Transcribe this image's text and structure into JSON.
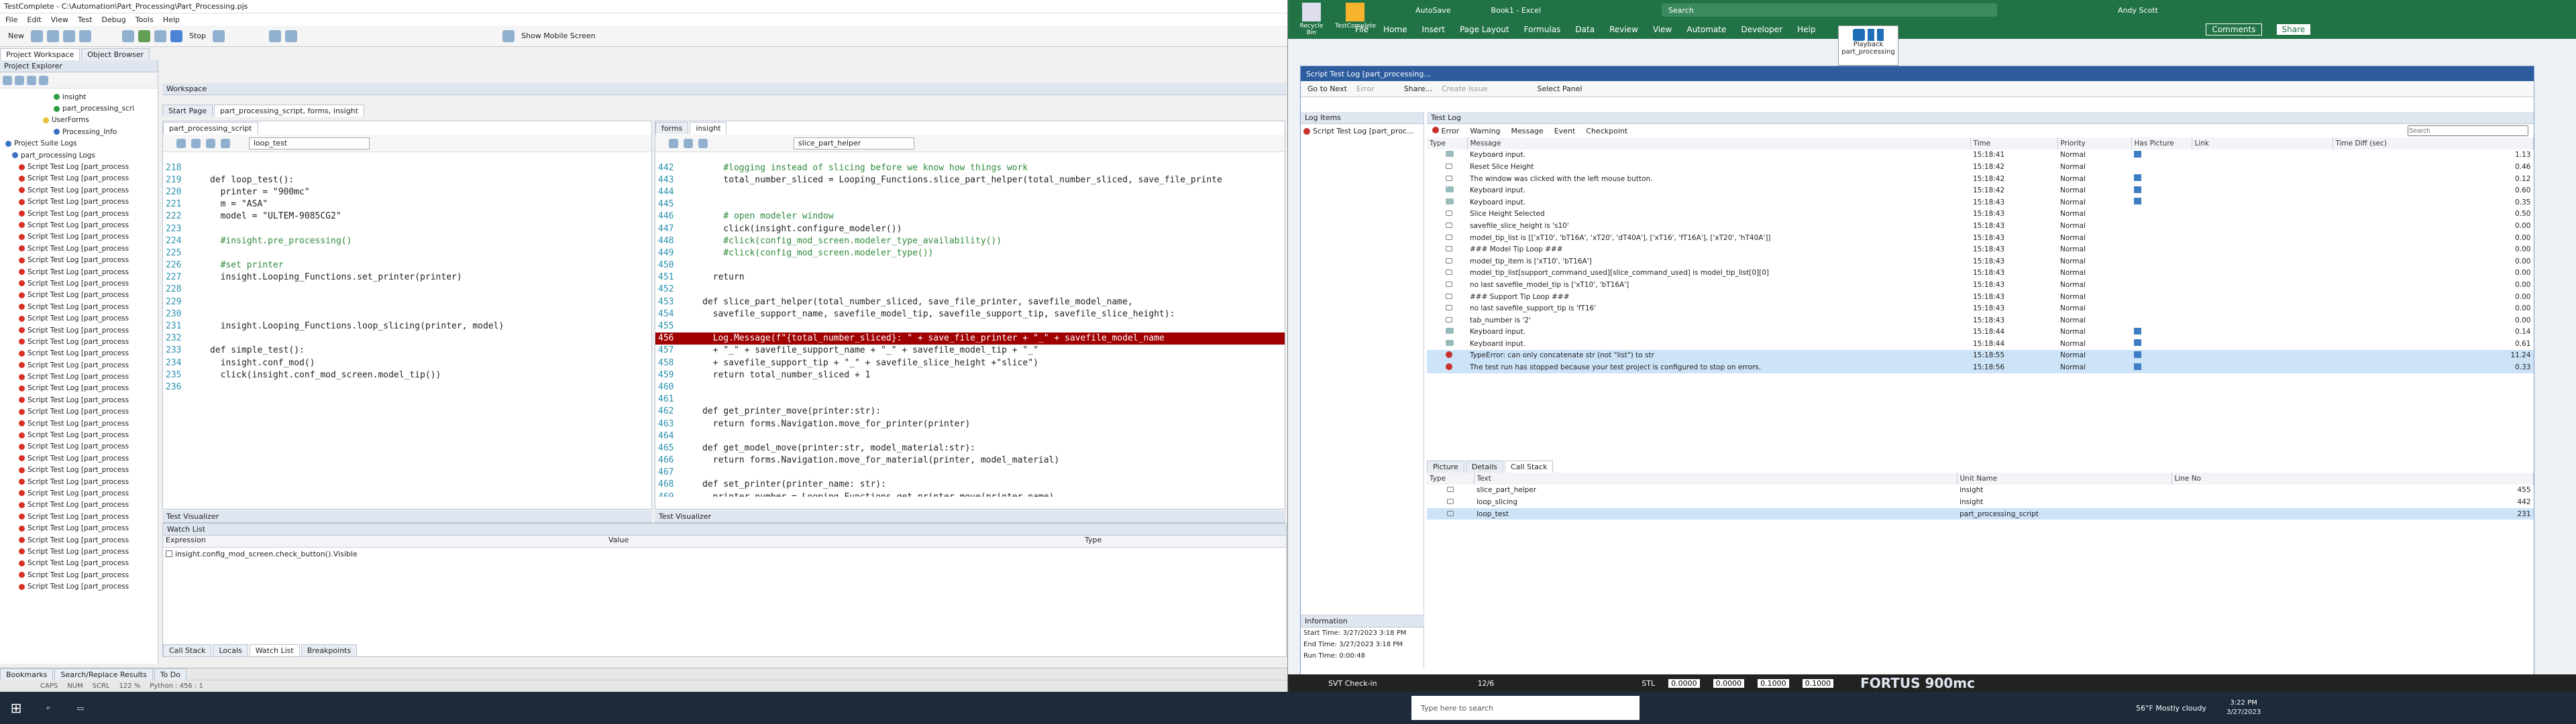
{
  "tc": {
    "title": "TestComplete - C:\\Automation\\Part_Processing\\Part_Processing.pjs",
    "menu": [
      "File",
      "Edit",
      "View",
      "Test",
      "Debug",
      "Tools",
      "Help"
    ],
    "toolbar": {
      "new": "New",
      "stop": "Stop",
      "mobile": "Show Mobile Screen"
    },
    "left_tabs": [
      "Project Workspace",
      "Object Browser"
    ],
    "explorer_title": "Project Explorer",
    "tree_top": [
      {
        "label": "insight",
        "color": "grn",
        "indent": 80
      },
      {
        "label": "part_processing_scri",
        "color": "grn",
        "indent": 80
      },
      {
        "label": "UserForms",
        "color": "yel",
        "indent": 64
      },
      {
        "label": "Processing_Info",
        "color": "blu",
        "indent": 80
      },
      {
        "label": "Project Suite Logs",
        "color": "blu",
        "indent": 8
      },
      {
        "label": "part_processing Logs",
        "color": "blu",
        "indent": 18
      }
    ],
    "log_item": "Script Test Log [part_process",
    "log_count": 37,
    "workspace_title": "Workspace",
    "workspace_tabs": [
      "Start Page",
      "part_processing_script, forms, insight"
    ],
    "ed1_tab": "part_processing_script",
    "ed1_func": "loop_test",
    "ed2_tabs": [
      "forms",
      "insight"
    ],
    "ed2_func": "slice_part_helper",
    "ed1_lines": [
      {
        "n": "218",
        "t": ""
      },
      {
        "n": "219",
        "t": "def loop_test():"
      },
      {
        "n": "220",
        "t": "  printer = \"900mc\""
      },
      {
        "n": "221",
        "t": "  m = \"ASA\""
      },
      {
        "n": "222",
        "t": "  model = \"ULTEM-9085CG2\""
      },
      {
        "n": "223",
        "t": ""
      },
      {
        "n": "224",
        "t": "  #insight.pre_processing()"
      },
      {
        "n": "225",
        "t": ""
      },
      {
        "n": "226",
        "t": "  #set printer"
      },
      {
        "n": "227",
        "t": "  insight.Looping_Functions.set_printer(printer)"
      },
      {
        "n": "228",
        "t": ""
      },
      {
        "n": "229",
        "t": ""
      },
      {
        "n": "230",
        "t": ""
      },
      {
        "n": "231",
        "t": "  insight.Looping_Functions.loop_slicing(printer, model)"
      },
      {
        "n": "232",
        "t": ""
      },
      {
        "n": "233",
        "t": "def simple_test():"
      },
      {
        "n": "234",
        "t": "  insight.conf_mod()"
      },
      {
        "n": "235",
        "t": "  click(insight.conf_mod_screen.model_tip())"
      },
      {
        "n": "236",
        "t": ""
      }
    ],
    "ed2_lines": [
      {
        "n": "442",
        "t": "    #logging instead of slicing before we know how things work"
      },
      {
        "n": "443",
        "t": "    total_number_sliced = Looping_Functions.slice_part_helper(total_number_sliced, save_file_printe"
      },
      {
        "n": "444",
        "t": ""
      },
      {
        "n": "445",
        "t": ""
      },
      {
        "n": "446",
        "t": "    # open modeler window"
      },
      {
        "n": "447",
        "t": "    click(insight.configure_modeler())"
      },
      {
        "n": "448",
        "t": "    #click(config_mod_screen.modeler_type_availability())"
      },
      {
        "n": "449",
        "t": "    #click(config_mod_screen.modeler_type())"
      },
      {
        "n": "450",
        "t": ""
      },
      {
        "n": "451",
        "t": "  return"
      },
      {
        "n": "452",
        "t": ""
      },
      {
        "n": "453",
        "t": "def slice_part_helper(total_number_sliced, save_file_printer, savefile_model_name,"
      },
      {
        "n": "454",
        "t": "  savefile_support_name, savefile_model_tip, savefile_support_tip, savefile_slice_height):"
      },
      {
        "n": "455",
        "t": ""
      },
      {
        "n": "456",
        "t": "  Log.Message(f\"{total_number_sliced}: \" + save_file_printer + \"_\" + savefile_model_name",
        "hl": true
      },
      {
        "n": "457",
        "t": "  + \"_\" + savefile_support_name + \"_\" + savefile_model_tip + \"_\""
      },
      {
        "n": "458",
        "t": "  + savefile_support_tip + \"_\" + savefile_slice_height +\"slice\")"
      },
      {
        "n": "459",
        "t": "  return total_number_sliced + 1"
      },
      {
        "n": "460",
        "t": ""
      },
      {
        "n": "461",
        "t": ""
      },
      {
        "n": "462",
        "t": "def get_printer_move(printer:str):"
      },
      {
        "n": "463",
        "t": "  return forms.Navigation.move_for_printer(printer)"
      },
      {
        "n": "464",
        "t": ""
      },
      {
        "n": "465",
        "t": "def get_model_move(printer:str, model_material:str):"
      },
      {
        "n": "466",
        "t": "  return forms.Navigation.move_for_material(printer, model_material)"
      },
      {
        "n": "467",
        "t": ""
      },
      {
        "n": "468",
        "t": "def set_printer(printer_name: str):"
      },
      {
        "n": "469",
        "t": "  printer_number = Looping_Functions.get_printer_move(printer_name)"
      }
    ],
    "visualizer": "Test Visualizer",
    "watch_title": "Watch List",
    "watch_cols": [
      "Expression",
      "Value",
      "Type"
    ],
    "watch_row": "insight.config_mod_screen.check_button().Visible",
    "bottom_tabs": [
      "Call Stack",
      "Locals",
      "Watch List",
      "Breakpoints"
    ],
    "footer_tabs": [
      "Bookmarks",
      "Search/Replace Results",
      "To Do"
    ],
    "status": {
      "caps": "CAPS",
      "num": "NUM",
      "scrl": "SCRL",
      "zoom": "122 %",
      "pos": "Python : 456 : 1"
    }
  },
  "excel": {
    "title": "Book1 - Excel",
    "search": "Search",
    "user": "Andy Scott",
    "autosave": "AutoSave",
    "menu": [
      "File",
      "Home",
      "Insert",
      "Page Layout",
      "Formulas",
      "Data",
      "Review",
      "View",
      "Automate",
      "Developer",
      "Help"
    ],
    "comments": "Comments",
    "share": "Share",
    "desk_icons": [
      "Recycle Bin",
      "TestComplete"
    ],
    "playback": "Playback",
    "playback_sub": "part_processing",
    "bottom_taskbtn": "SVT Check-in",
    "page": "12/6",
    "fortus": "FORTUS 900mc",
    "coords": {
      "x": "0.0000",
      "y": "0.0000",
      "z": "0.1000",
      "d2": "0.1000",
      "label": "STL"
    }
  },
  "stl": {
    "title": "Script Test Log [part_processing...",
    "toolbar": [
      "Go to Next",
      "Error",
      "Share...",
      "Create Issue",
      "Select Panel"
    ],
    "log_items_title": "Log Items",
    "log_root": "Script Test Log [part_proc...",
    "info_title": "Information",
    "start": "Start Time: 3/27/2023 3:18 PM",
    "end": "End Time: 3/27/2023 3:18 PM",
    "run": "Run Time: 0:00:48",
    "testlog_title": "Test Log",
    "filters": [
      "Error",
      "Warning",
      "Message",
      "Event",
      "Checkpoint"
    ],
    "search_placeholder": "Search",
    "cols": [
      "Type",
      "Message",
      "Time",
      "Priority",
      "Has Picture",
      "Link",
      "Time Diff (sec)"
    ],
    "rows": [
      [
        "K",
        "Keyboard input.",
        "15:18:41",
        "Normal",
        "1",
        "",
        "1.13"
      ],
      [
        "M",
        "Reset Slice Height",
        "15:18:42",
        "Normal",
        "0",
        "",
        "0.46"
      ],
      [
        "M",
        "The window was clicked with the left mouse button.",
        "15:18:42",
        "Normal",
        "1",
        "",
        "0.12"
      ],
      [
        "K",
        "Keyboard input.",
        "15:18:42",
        "Normal",
        "1",
        "",
        "0.60"
      ],
      [
        "K",
        "Keyboard input.",
        "15:18:43",
        "Normal",
        "1",
        "",
        "0.35"
      ],
      [
        "M",
        "Slice Height Selected",
        "15:18:43",
        "Normal",
        "0",
        "",
        "0.50"
      ],
      [
        "M",
        "savefile_slice_height is 's10'",
        "15:18:43",
        "Normal",
        "0",
        "",
        "0.00"
      ],
      [
        "M",
        "model_tip_list is [['xT10', 'bT16A', 'xT20', 'dT40A'], ['xT16', 'fT16A'], ['xT20', 'hT40A']]",
        "15:18:43",
        "Normal",
        "0",
        "",
        "0.00"
      ],
      [
        "M",
        "### Model Tip Loop ###",
        "15:18:43",
        "Normal",
        "0",
        "",
        "0.00"
      ],
      [
        "M",
        "model_tip_item is ['xT10', 'bT16A']",
        "15:18:43",
        "Normal",
        "0",
        "",
        "0.00"
      ],
      [
        "M",
        "model_tip_list[support_command_used][slice_command_used] is model_tip_list[0][0]",
        "15:18:43",
        "Normal",
        "0",
        "",
        "0.00"
      ],
      [
        "M",
        "no last savefile_model_tip is ['xT10', 'bT16A']",
        "15:18:43",
        "Normal",
        "0",
        "",
        "0.00"
      ],
      [
        "M",
        "### Support Tip Loop ###",
        "15:18:43",
        "Normal",
        "0",
        "",
        "0.00"
      ],
      [
        "M",
        "no last savefile_support_tip is 'fT16'",
        "15:18:43",
        "Normal",
        "0",
        "",
        "0.00"
      ],
      [
        "M",
        "tab_number is '2'",
        "15:18:43",
        "Normal",
        "0",
        "",
        "0.00"
      ],
      [
        "K",
        "Keyboard input.",
        "15:18:44",
        "Normal",
        "1",
        "",
        "0.14"
      ],
      [
        "K",
        "Keyboard input.",
        "15:18:44",
        "Normal",
        "1",
        "",
        "0.61"
      ],
      [
        "E",
        "TypeError: can only concatenate str (not \"list\") to str",
        "15:18:55",
        "Normal",
        "1",
        "",
        "11.24"
      ],
      [
        "E",
        "The test run has stopped because your test project is configured to stop on errors.",
        "15:18:56",
        "Normal",
        "1",
        "",
        "0.33"
      ]
    ],
    "detail_tabs": [
      "Picture",
      "Details",
      "Call Stack"
    ],
    "cs_cols": [
      "Type",
      "Text",
      "Unit Name",
      "Line No"
    ],
    "cs_rows": [
      [
        "slice_part_helper",
        "insight",
        "455"
      ],
      [
        "loop_slicing",
        "insight",
        "442"
      ],
      [
        "loop_test",
        "part_processing_script",
        "231"
      ]
    ]
  },
  "taskbar": {
    "search": "Type here to search",
    "time": "3:22 PM",
    "date": "3/27/2023",
    "weather": "56°F  Mostly cloudy"
  },
  "colors": {
    "accent": "#2d5d9f",
    "excel": "#217346",
    "error": "#c8302b",
    "highlight": "#a00000"
  }
}
